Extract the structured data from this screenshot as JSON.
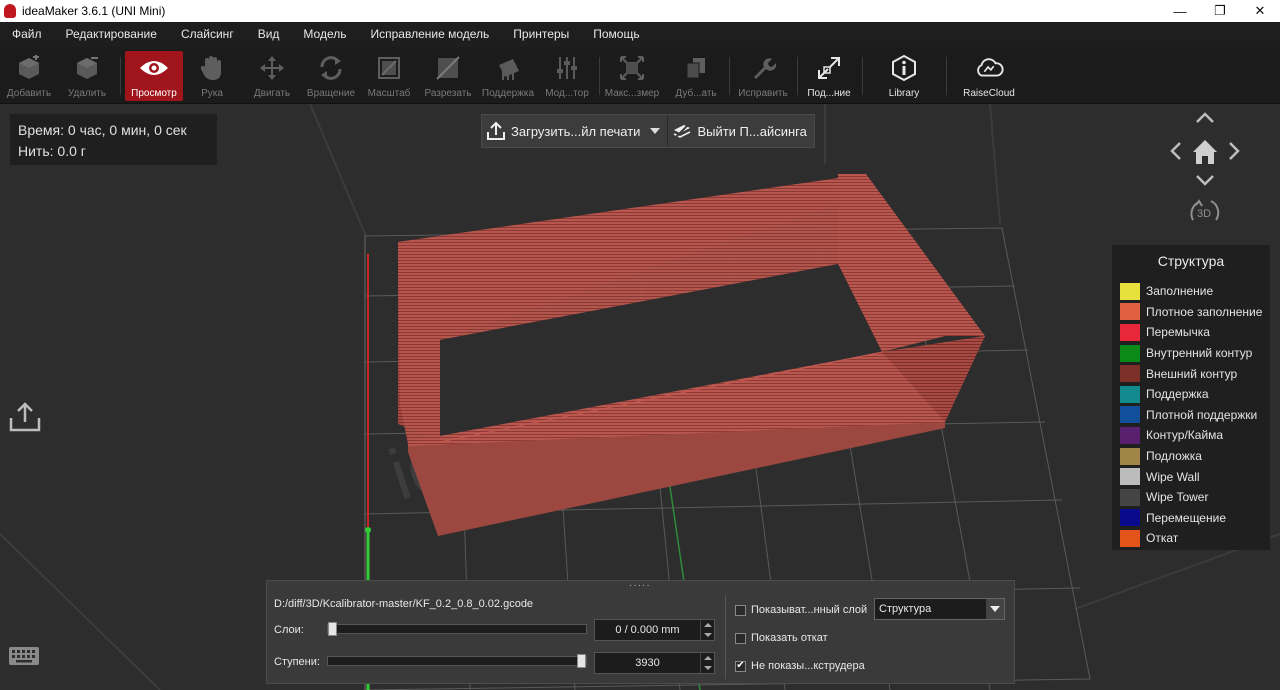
{
  "window": {
    "title": "ideaMaker 3.6.1 (UNI Mini)",
    "controls": {
      "minimize": "—",
      "maximize": "❐",
      "close": "✕"
    }
  },
  "menu": [
    "Файл",
    "Редактирование",
    "Слайсинг",
    "Вид",
    "Модель",
    "Исправление модель",
    "Принтеры",
    "Помощь"
  ],
  "toolbar": {
    "add": "Добавить",
    "remove": "Удалить",
    "preview": "Просмотр",
    "hand": "Рука",
    "move": "Двигать",
    "rotate": "Вращение",
    "scale": "Масштаб",
    "cut": "Разрезать",
    "support": "Поддержка",
    "modifier": "Мод...тор",
    "maxsize": "Макс...змер",
    "duplicate": "Дуб...ать",
    "repair": "Исправить",
    "fit": "Под...ние",
    "library": "Library",
    "raisecloud": "RaiseCloud"
  },
  "info": {
    "time": "Время: 0 час, 0 мин, 0 сек",
    "filament": "Нить: 0.0 г"
  },
  "viewport_buttons": {
    "upload": "Загрузить...йл печати",
    "exit": "Выйти П...айсинга"
  },
  "watermark": "ideaMaker",
  "nav": {
    "mode_3d": "3D"
  },
  "legend": {
    "title": "Структура",
    "items": [
      {
        "label": "Заполнение",
        "color": "#e8e03c"
      },
      {
        "label": "Плотное заполнение",
        "color": "#e0603f"
      },
      {
        "label": "Перемычка",
        "color": "#e8283a"
      },
      {
        "label": "Внутренний контур",
        "color": "#0c8a18"
      },
      {
        "label": "Внешний контур",
        "color": "#7d3027"
      },
      {
        "label": "Поддержка",
        "color": "#128a8e"
      },
      {
        "label": "Плотной поддержки",
        "color": "#124f9a"
      },
      {
        "label": "Контур/Кайма",
        "color": "#5a2070"
      },
      {
        "label": "Подложка",
        "color": "#a08646"
      },
      {
        "label": "Wipe Wall",
        "color": "#bcbcbc"
      },
      {
        "label": "Wipe Tower",
        "color": "#444444"
      },
      {
        "label": "Перемещение",
        "color": "#0a0a8c"
      },
      {
        "label": "Откат",
        "color": "#e2541a"
      }
    ]
  },
  "panel": {
    "filepath": "D:/diff/3D/Kcalibrator-master/KF_0.2_0.8_0.02.gcode",
    "layers_label": "Слои:",
    "layers_value": "0 / 0.000 mm",
    "layers_fraction": 0,
    "steps_label": "Ступени:",
    "steps_value": "3930",
    "steps_fraction": 1,
    "show_single_layer": "Показыват...нный слой",
    "show_retraction": "Показать откат",
    "hide_extruder": "Не показы...кструдера",
    "show_single_layer_checked": false,
    "show_retraction_checked": false,
    "hide_extruder_checked": true,
    "view_mode": "Структура"
  }
}
